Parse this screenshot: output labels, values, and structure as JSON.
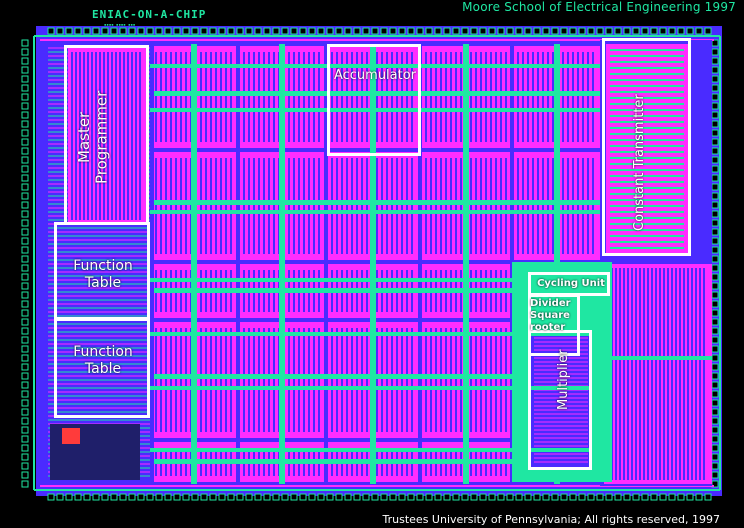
{
  "header": {
    "chip_title": "ENIAC-ON-A-CHIP",
    "school_title": "Moore School of Electrical Engineering 1997"
  },
  "footer": {
    "copyright": "Trustees University of Pennsylvania; All rights reserved, 1997"
  },
  "units": {
    "master_programmer": "Master Programmer",
    "accumulator": "Accumulator",
    "constant_transmitter": "Constant Transmitter",
    "function_table_1": "Function Table",
    "function_table_2": "Function Table",
    "cycling_unit": "Cycling Unit",
    "divider_square_rooter": "Divider Square rooter",
    "multiplier": "Multiplier"
  },
  "colors": {
    "background": "#000000",
    "metal1": "#ff2dff",
    "metal2": "#1fe7a2",
    "poly": "#4a2bff",
    "label": "#ffffff"
  }
}
